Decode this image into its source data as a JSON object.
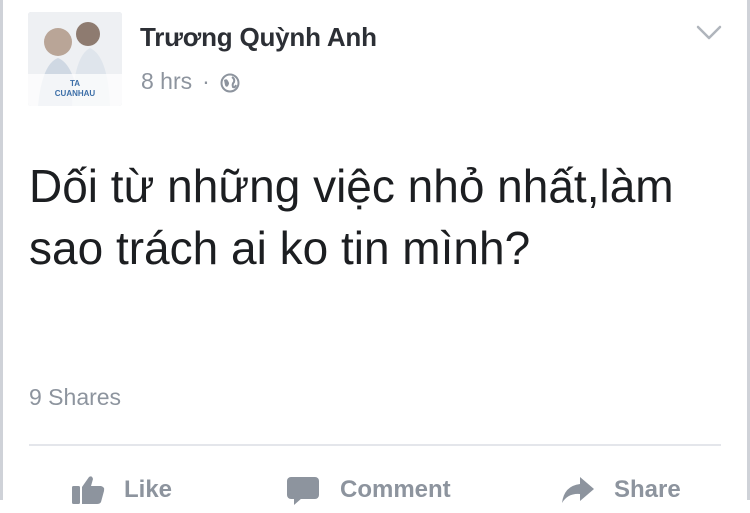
{
  "post": {
    "author": "Trương Quỳnh Anh",
    "time": "8 hrs",
    "separator": "·",
    "privacy_icon": "globe-icon",
    "menu_icon": "chevron-down-icon",
    "text": "Dối từ những việc nhỏ nhất,làm sao trách ai ko tin mình?",
    "shares": "9 Shares",
    "avatar_caption": "TA CUANHAU"
  },
  "actions": [
    {
      "label": "Like",
      "icon": "thumbs-up-icon"
    },
    {
      "label": "Comment",
      "icon": "comment-icon"
    },
    {
      "label": "Share",
      "icon": "share-arrow-icon"
    }
  ],
  "colors": {
    "text_primary": "#1c1e21",
    "text_secondary": "#8d949e",
    "divider": "#e4e6eb"
  }
}
